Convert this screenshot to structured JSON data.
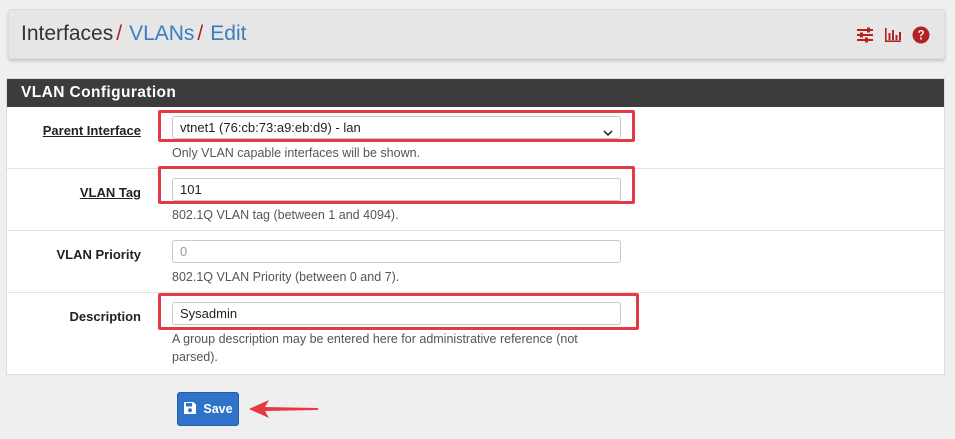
{
  "breadcrumb": {
    "items": [
      {
        "label": "Interfaces",
        "link": false
      },
      {
        "label": "VLANs",
        "link": true
      },
      {
        "label": "Edit",
        "link": true
      }
    ],
    "separator": "/"
  },
  "header_icons": [
    "sliders-icon",
    "bar-chart-icon",
    "help-icon"
  ],
  "panel": {
    "title": "VLAN Configuration",
    "fields": {
      "parent_interface": {
        "label": "Parent Interface",
        "value": "vtnet1 (76:cb:73:a9:eb:d9) - lan",
        "help": "Only VLAN capable interfaces will be shown."
      },
      "vlan_tag": {
        "label": "VLAN Tag",
        "value": "101",
        "help": "802.1Q VLAN tag (between 1 and 4094)."
      },
      "vlan_priority": {
        "label": "VLAN Priority",
        "placeholder": "0",
        "help": "802.1Q VLAN Priority (between 0 and 7)."
      },
      "description": {
        "label": "Description",
        "value": "Sysadmin",
        "help": "A group description may be entered here for administrative reference (not parsed)."
      }
    }
  },
  "save_button": {
    "label": "Save"
  },
  "colors": {
    "accent": "#3b7cc4",
    "separator": "#b22222",
    "panel_heading": "#3c3c3c",
    "highlight": "#e63946",
    "button": "#2f73c9"
  }
}
